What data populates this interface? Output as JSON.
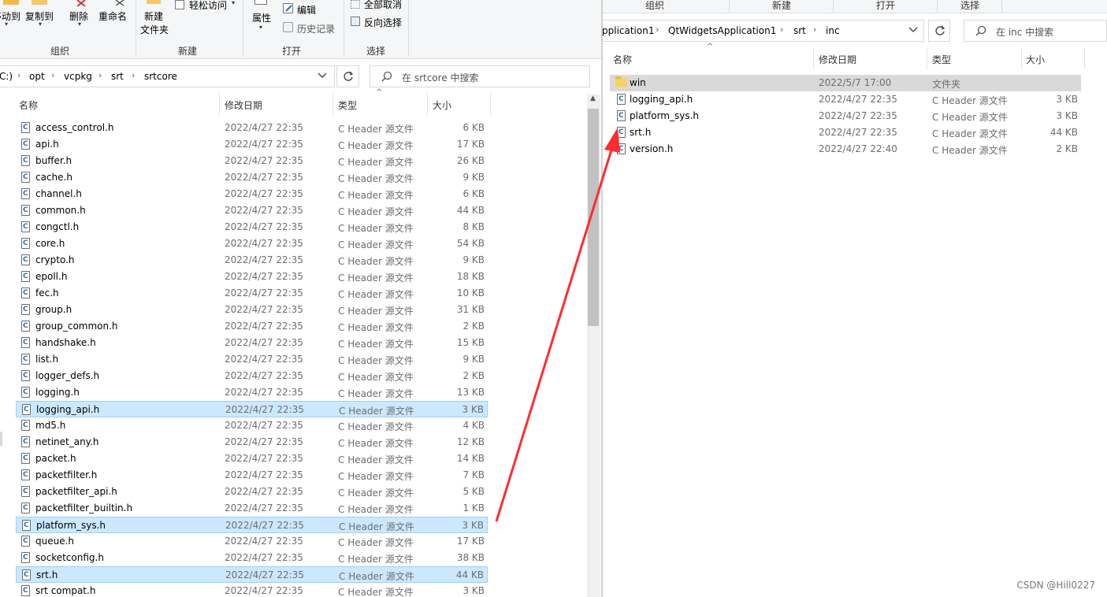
{
  "left_window": {
    "ribbon": {
      "move_to": "移动到",
      "copy_to": "复制到",
      "delete": "删除",
      "rename": "重命名",
      "new_folder_line1": "新建",
      "new_folder_line2": "文件夹",
      "easy_access": "轻松访问",
      "properties": "属性",
      "edit": "编辑",
      "history": "历史记录",
      "select_none": "全部取消",
      "invert_selection": "反向选择",
      "groups": {
        "organize": "组织",
        "new": "新建",
        "open": "打开",
        "select": "选择"
      }
    },
    "address": {
      "crumbs": [
        "C:)",
        "opt",
        "vcpkg",
        "srt",
        "srtcore"
      ]
    },
    "search": {
      "placeholder": "在 srtcore 中搜索"
    },
    "columns": {
      "name": "名称",
      "date": "修改日期",
      "type": "类型",
      "size": "大小"
    },
    "files": [
      {
        "name": "access_control.h",
        "date": "2022/4/27 22:35",
        "type": "C Header 源文件",
        "size": "6 KB",
        "selected": false
      },
      {
        "name": "api.h",
        "date": "2022/4/27 22:35",
        "type": "C Header 源文件",
        "size": "17 KB",
        "selected": false
      },
      {
        "name": "buffer.h",
        "date": "2022/4/27 22:35",
        "type": "C Header 源文件",
        "size": "26 KB",
        "selected": false
      },
      {
        "name": "cache.h",
        "date": "2022/4/27 22:35",
        "type": "C Header 源文件",
        "size": "9 KB",
        "selected": false
      },
      {
        "name": "channel.h",
        "date": "2022/4/27 22:35",
        "type": "C Header 源文件",
        "size": "6 KB",
        "selected": false
      },
      {
        "name": "common.h",
        "date": "2022/4/27 22:35",
        "type": "C Header 源文件",
        "size": "44 KB",
        "selected": false
      },
      {
        "name": "congctl.h",
        "date": "2022/4/27 22:35",
        "type": "C Header 源文件",
        "size": "8 KB",
        "selected": false
      },
      {
        "name": "core.h",
        "date": "2022/4/27 22:35",
        "type": "C Header 源文件",
        "size": "54 KB",
        "selected": false
      },
      {
        "name": "crypto.h",
        "date": "2022/4/27 22:35",
        "type": "C Header 源文件",
        "size": "9 KB",
        "selected": false
      },
      {
        "name": "epoll.h",
        "date": "2022/4/27 22:35",
        "type": "C Header 源文件",
        "size": "18 KB",
        "selected": false
      },
      {
        "name": "fec.h",
        "date": "2022/4/27 22:35",
        "type": "C Header 源文件",
        "size": "10 KB",
        "selected": false
      },
      {
        "name": "group.h",
        "date": "2022/4/27 22:35",
        "type": "C Header 源文件",
        "size": "31 KB",
        "selected": false
      },
      {
        "name": "group_common.h",
        "date": "2022/4/27 22:35",
        "type": "C Header 源文件",
        "size": "2 KB",
        "selected": false
      },
      {
        "name": "handshake.h",
        "date": "2022/4/27 22:35",
        "type": "C Header 源文件",
        "size": "15 KB",
        "selected": false
      },
      {
        "name": "list.h",
        "date": "2022/4/27 22:35",
        "type": "C Header 源文件",
        "size": "9 KB",
        "selected": false
      },
      {
        "name": "logger_defs.h",
        "date": "2022/4/27 22:35",
        "type": "C Header 源文件",
        "size": "2 KB",
        "selected": false
      },
      {
        "name": "logging.h",
        "date": "2022/4/27 22:35",
        "type": "C Header 源文件",
        "size": "13 KB",
        "selected": false
      },
      {
        "name": "logging_api.h",
        "date": "2022/4/27 22:35",
        "type": "C Header 源文件",
        "size": "3 KB",
        "selected": true
      },
      {
        "name": "md5.h",
        "date": "2022/4/27 22:35",
        "type": "C Header 源文件",
        "size": "4 KB",
        "selected": false
      },
      {
        "name": "netinet_any.h",
        "date": "2022/4/27 22:35",
        "type": "C Header 源文件",
        "size": "12 KB",
        "selected": false
      },
      {
        "name": "packet.h",
        "date": "2022/4/27 22:35",
        "type": "C Header 源文件",
        "size": "14 KB",
        "selected": false
      },
      {
        "name": "packetfilter.h",
        "date": "2022/4/27 22:35",
        "type": "C Header 源文件",
        "size": "7 KB",
        "selected": false
      },
      {
        "name": "packetfilter_api.h",
        "date": "2022/4/27 22:35",
        "type": "C Header 源文件",
        "size": "5 KB",
        "selected": false
      },
      {
        "name": "packetfilter_builtin.h",
        "date": "2022/4/27 22:35",
        "type": "C Header 源文件",
        "size": "1 KB",
        "selected": false
      },
      {
        "name": "platform_sys.h",
        "date": "2022/4/27 22:35",
        "type": "C Header 源文件",
        "size": "3 KB",
        "selected": true
      },
      {
        "name": "queue.h",
        "date": "2022/4/27 22:35",
        "type": "C Header 源文件",
        "size": "17 KB",
        "selected": false
      },
      {
        "name": "socketconfig.h",
        "date": "2022/4/27 22:35",
        "type": "C Header 源文件",
        "size": "38 KB",
        "selected": false
      },
      {
        "name": "srt.h",
        "date": "2022/4/27 22:35",
        "type": "C Header 源文件",
        "size": "44 KB",
        "selected": true
      },
      {
        "name": "srt compat.h",
        "date": "2022/4/27 22:35",
        "type": "C Header 源文件",
        "size": "3 KB",
        "selected": false
      }
    ]
  },
  "right_window": {
    "tabs": {
      "organize": "组织",
      "new": "新建",
      "open": "打开",
      "select": "选择"
    },
    "address": {
      "crumbs": [
        "pplication1",
        "QtWidgetsApplication1",
        "srt",
        "inc"
      ]
    },
    "search": {
      "placeholder": "在 inc 中搜索"
    },
    "columns": {
      "name": "名称",
      "date": "修改日期",
      "type": "类型",
      "size": "大小"
    },
    "files": [
      {
        "name": "win",
        "date": "2022/5/7 17:00",
        "type": "文件夹",
        "size": "",
        "kind": "folder"
      },
      {
        "name": "logging_api.h",
        "date": "2022/4/27 22:35",
        "type": "C Header 源文件",
        "size": "3 KB",
        "kind": "file"
      },
      {
        "name": "platform_sys.h",
        "date": "2022/4/27 22:35",
        "type": "C Header 源文件",
        "size": "3 KB",
        "kind": "file"
      },
      {
        "name": "srt.h",
        "date": "2022/4/27 22:35",
        "type": "C Header 源文件",
        "size": "44 KB",
        "kind": "file"
      },
      {
        "name": "version.h",
        "date": "2022/4/27 22:40",
        "type": "C Header 源文件",
        "size": "2 KB",
        "kind": "file"
      }
    ]
  },
  "watermark": "CSDN @Hill0227",
  "colors": {
    "selection": "#cce8ff",
    "selection_border": "#99d1ff",
    "arrow": "#ff2d2d",
    "folder": "#f7d06b"
  }
}
